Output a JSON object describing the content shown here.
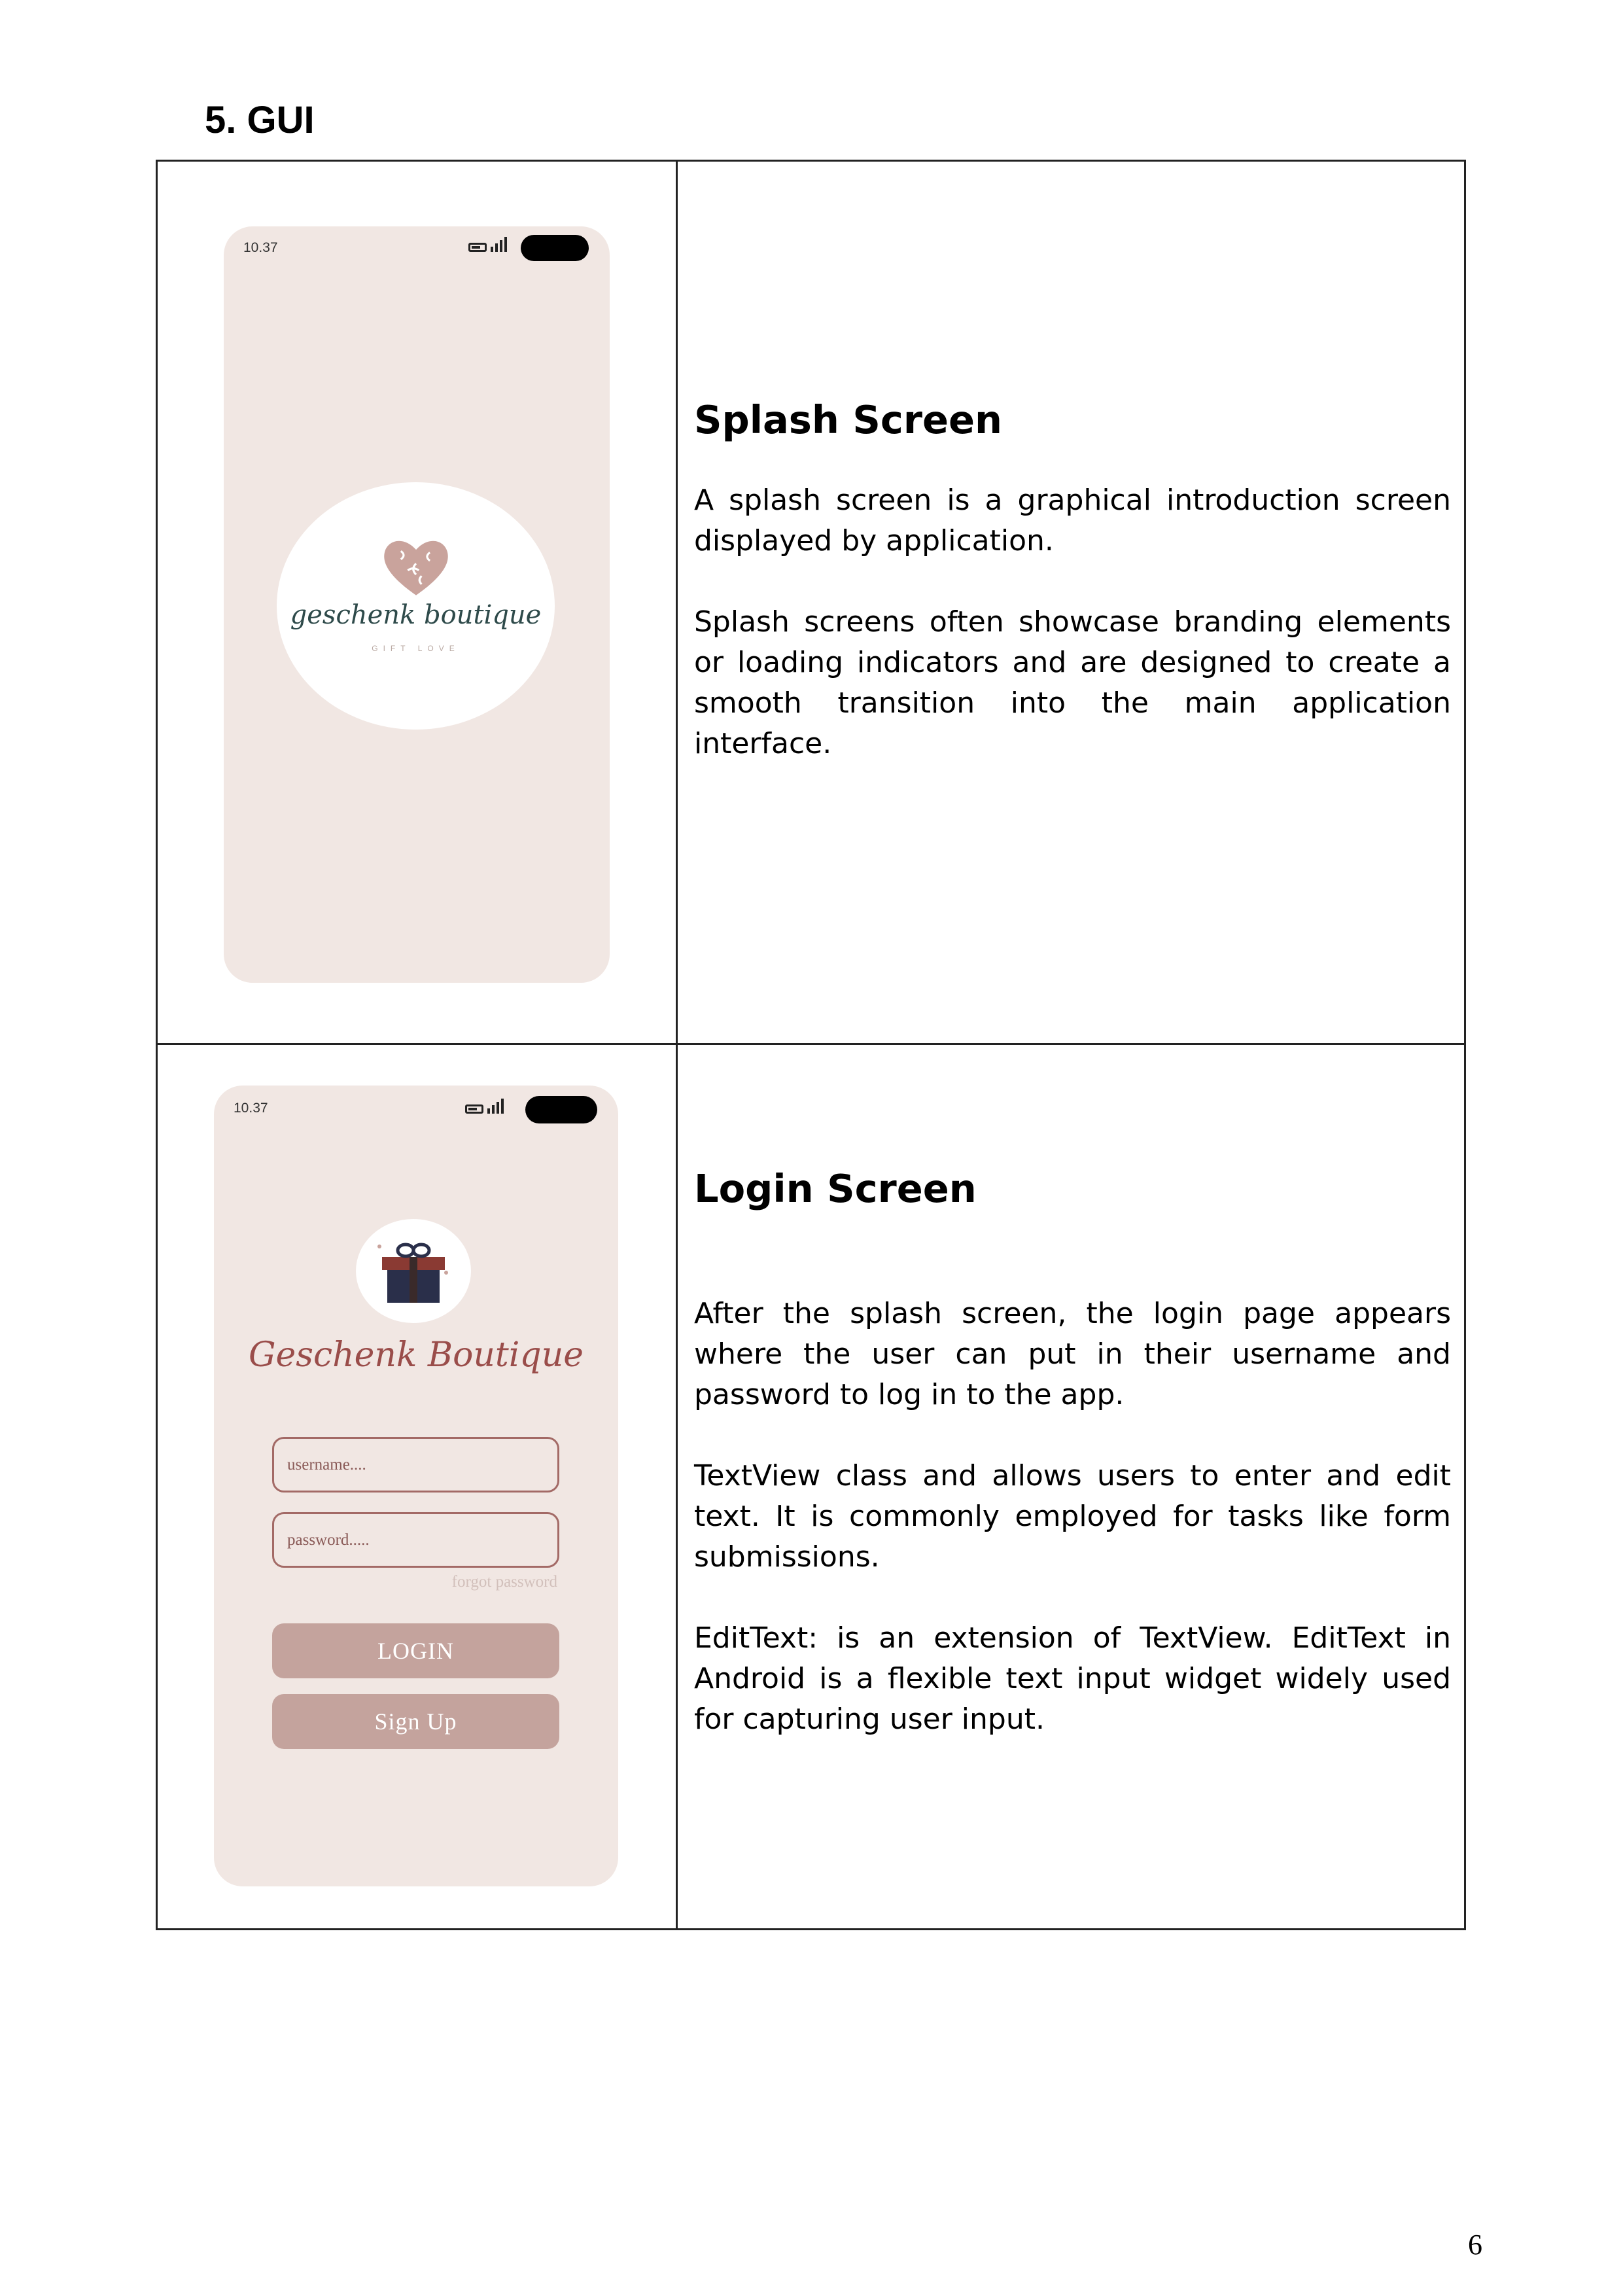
{
  "section_title": "5. GUI",
  "rows": [
    {
      "title": "Splash Screen",
      "paragraphs": [
        "A splash screen is a graphical introduction screen displayed by application.",
        "Splash screens often showcase branding elements or loading indicators and are designed to create a smooth transition into the main application interface."
      ],
      "phone": {
        "status_time": "10.37",
        "brand_name": "geschenk boutique",
        "brand_tagline": "GIFT LOVE"
      }
    },
    {
      "title": "Login Screen",
      "paragraphs": [
        "After the splash screen, the login page appears where the user can put in their username and password to log in to the app.",
        "TextView class and allows users to enter and edit text. It is commonly employed for tasks like form submissions.",
        "EditText:  is an extension of TextView. EditText in Android is a flexible text input widget widely used for capturing user input."
      ],
      "phone": {
        "status_time": "10.37",
        "brand_name": "Geschenk Boutique",
        "username_placeholder": "username....",
        "password_placeholder": "password.....",
        "forgot_password": "forgot password",
        "login_label": "LOGIN",
        "signup_label": "Sign Up"
      }
    }
  ],
  "page_number": "6",
  "colors": {
    "phone_bg": "#f1e7e3",
    "button_bg": "#c4a39d",
    "input_border": "#a36a66",
    "brand_teal": "#2e4a4a",
    "brand_rose": "#9a4d4a",
    "heart": "#c9a39c"
  },
  "icons": [
    "battery-icon",
    "signal-icon",
    "heart-puzzle-logo",
    "gift-box-logo"
  ]
}
